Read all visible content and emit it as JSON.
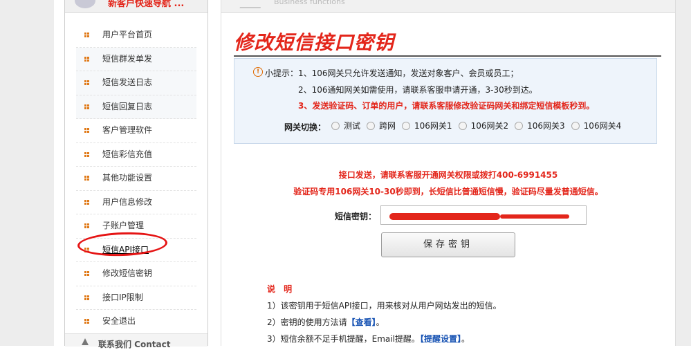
{
  "sidebar": {
    "header": "新客户快速导航 ...",
    "items": [
      {
        "label": "用户平台首页"
      },
      {
        "label": "短信群发单发"
      },
      {
        "label": "短信发送日志"
      },
      {
        "label": "短信回复日志"
      },
      {
        "label": "客户管理软件"
      },
      {
        "label": "短信彩信充值"
      },
      {
        "label": "其他功能设置"
      },
      {
        "label": "用户信息修改"
      },
      {
        "label": "子账户管理"
      },
      {
        "label": "短信API接口"
      },
      {
        "label": "修改短信密钥"
      },
      {
        "label": "接口IP限制"
      },
      {
        "label": "安全退出"
      }
    ],
    "footer": "联系我们 Contact"
  },
  "main": {
    "header_text": "Business functions",
    "title": "修改短信接口密钥",
    "tips": {
      "prefix": "小提示：",
      "line1": "1、106网关只允许发送通知，发送对象客户、会员或员工；",
      "line2": "2、106通知网关如需使用，请联系客服申请开通，3-30秒到达。",
      "line3": "3、发送验证码、订单的用户，请联系客服修改验证码网关和绑定短信模板秒到。"
    },
    "gateway": {
      "label": "网关切换：",
      "options": [
        "测试",
        "跨网",
        "106网关1",
        "106网关2",
        "106网关3",
        "106网关4"
      ]
    },
    "notice1": "接口发送，请联系客服开通网关权限或拨打400-6991455",
    "notice2": "验证码专用106网关10-30秒即到，长短信比普通短信慢，验证码尽量发普通短信。",
    "key_label": "短信密钥：",
    "save_label": "保存密钥",
    "desc": {
      "title": "说 明",
      "row1": "1）该密钥用于短信API接口，用来核对从用户网站发出的短信。",
      "row2_text": "2）密钥的使用方法请",
      "row2_link": "【查看】",
      "row2_end": "。",
      "row3_text": "3）短信余额不足手机提醒，Email提醒。",
      "row3_link": "【提醒设置】",
      "row3_end": "。"
    }
  },
  "colors": {
    "accent_red": "#e3261b",
    "bullet_orange": "#e07a19",
    "link_blue": "#1a55b4",
    "tips_bg": "#eef4fb"
  }
}
